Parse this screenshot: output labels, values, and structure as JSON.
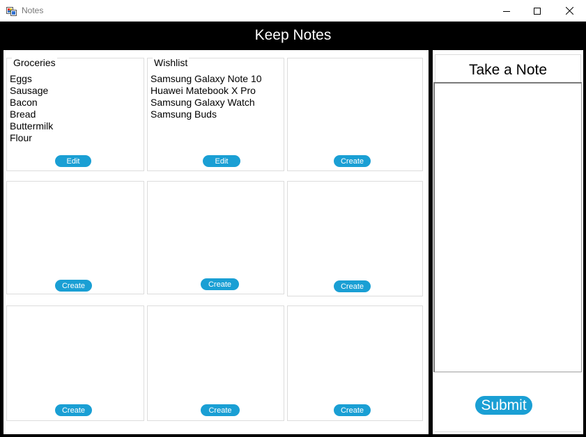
{
  "window": {
    "title": "Notes",
    "icon": "app-icon"
  },
  "header": {
    "title": "Keep Notes"
  },
  "notes": [
    {
      "legend": "Groceries",
      "lines": [
        "Eggs",
        "Sausage",
        "Bacon",
        "Bread",
        "Buttermilk",
        "Flour"
      ],
      "button": "Edit"
    },
    {
      "legend": "Wishlist",
      "lines": [
        " Samsung Galaxy Note 10",
        "Huawei Matebook X Pro",
        "Samsung Galaxy Watch",
        "Samsung Buds"
      ],
      "button": "Edit"
    },
    {
      "legend": "",
      "lines": [],
      "button": "Create"
    },
    {
      "legend": "",
      "lines": [],
      "button": "Create"
    },
    {
      "legend": "",
      "lines": [],
      "button": "Create"
    },
    {
      "legend": "",
      "lines": [],
      "button": "Create"
    },
    {
      "legend": "",
      "lines": [],
      "button": "Create"
    },
    {
      "legend": "",
      "lines": [],
      "button": "Create"
    },
    {
      "legend": "",
      "lines": [],
      "button": "Create"
    }
  ],
  "take_note": {
    "title": "Take a Note",
    "textarea_value": "",
    "submit_label": "Submit"
  },
  "colors": {
    "accent": "#1a9fd4",
    "header_bg": "#000000"
  }
}
